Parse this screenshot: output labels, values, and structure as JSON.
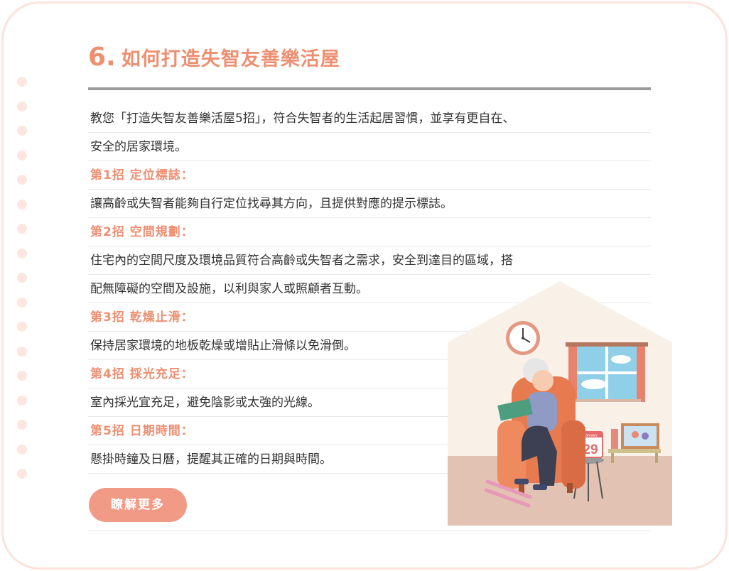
{
  "section": {
    "number": "6.",
    "title": "如何打造失智友善樂活屋"
  },
  "lines": [
    {
      "type": "text",
      "text": "教您「打造失智友善樂活屋5招」，符合失智者的生活起居習慣，並享有更自在、"
    },
    {
      "type": "text",
      "text": "安全的居家環境。"
    },
    {
      "type": "heading",
      "text": "第1招  定位標誌："
    },
    {
      "type": "text",
      "text": "讓高齡或失智者能夠自行定位找尋其方向，且提供對應的提示標誌。"
    },
    {
      "type": "heading",
      "text": "第2招  空間規劃："
    },
    {
      "type": "text",
      "text": "住宅內的空間尺度及環境品質符合高齡或失智者之需求，安全到達目的區域，搭"
    },
    {
      "type": "text",
      "text": "配無障礙的空間及設施，以利與家人或照顧者互動。"
    },
    {
      "type": "heading",
      "text": "第3招  乾燥止滑："
    },
    {
      "type": "text",
      "text": "保持居家環境的地板乾燥或增貼止滑條以免滑倒。"
    },
    {
      "type": "heading",
      "text": "第4招  採光充足："
    },
    {
      "type": "text",
      "text": "室內採光宜充足，避免陰影或太強的光線。"
    },
    {
      "type": "heading",
      "text": "第5招  日期時間："
    },
    {
      "type": "text",
      "text": "懸掛時鐘及日曆，提醒其正確的日期與時間。"
    }
  ],
  "button": {
    "label": "瞭解更多"
  },
  "illustration": {
    "calendar_month": "January",
    "calendar_day": "29",
    "icons": [
      "house-illustration",
      "wall-clock-icon",
      "window-icon",
      "calendar-icon",
      "photo-frame-icon",
      "armchair-icon"
    ]
  },
  "colors": {
    "accent": "#ee8f72",
    "button": "#f19a86",
    "card_border": "#fbe3dc",
    "dots": "#fde6e0"
  }
}
